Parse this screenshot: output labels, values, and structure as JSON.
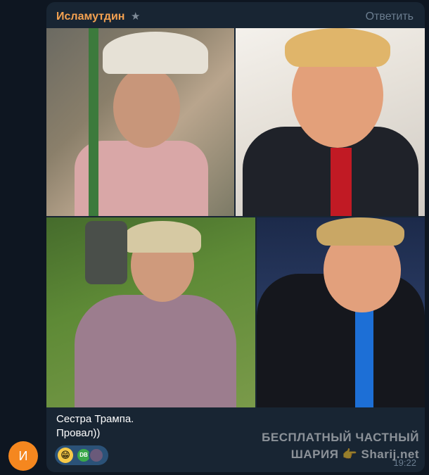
{
  "sender": {
    "name": "Исламутдин",
    "avatar_letter": "И",
    "avatar_color": "#f5871f"
  },
  "actions": {
    "reply_label": "Ответить"
  },
  "message": {
    "caption_line1": "Сестра Трампа.",
    "caption_line2": "Провал))",
    "time": "19:22"
  },
  "reactions": {
    "emoji": "😁",
    "avatar1_label": "DB"
  },
  "watermark": {
    "line1": "БЕСПЛАТНЫЙ ЧАСТНЫЙ",
    "line2": "ШАРИЯ 👉 Sharij.net"
  },
  "colors": {
    "background": "#0e1621",
    "bubble": "#182533",
    "sender_name": "#f5a251",
    "muted": "#6b7d8f"
  }
}
